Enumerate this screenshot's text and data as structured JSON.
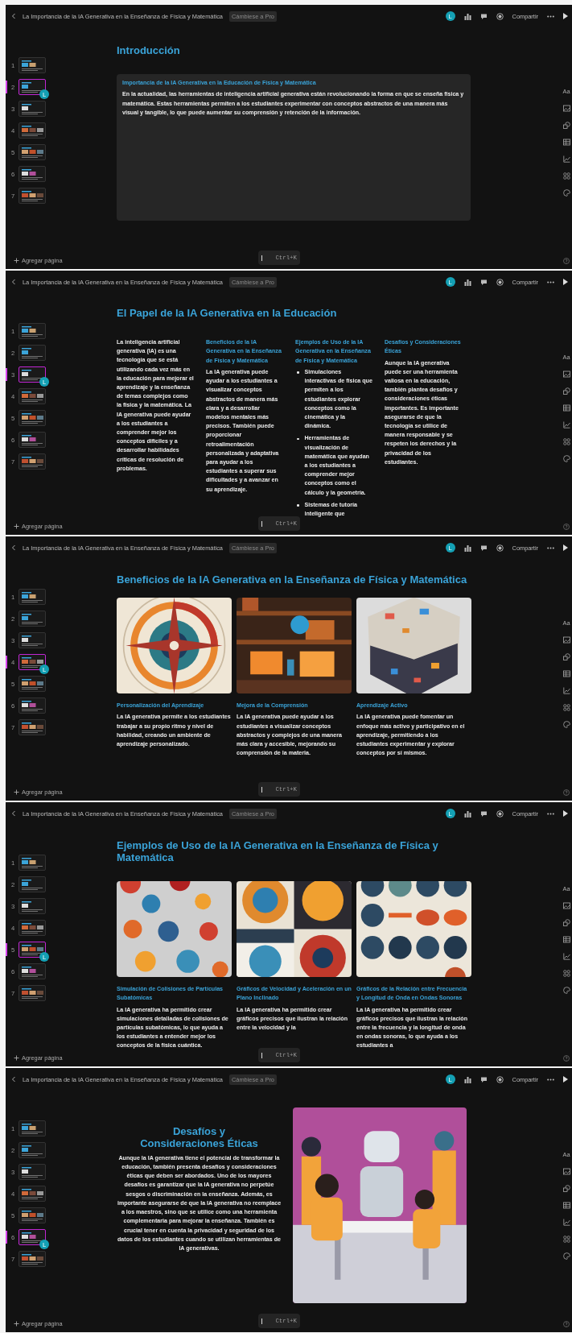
{
  "screens": [
    {
      "topbar": {
        "title": "La Importancia de la IA Generativa en la Enseñanza de Física y Matemática",
        "upgrade": "Cámbiese a Pro",
        "avatar": "L",
        "share": "Compartir"
      },
      "thumbnails": [
        {
          "number": "1",
          "selected": false
        },
        {
          "number": "2",
          "selected": true
        },
        {
          "number": "3",
          "selected": false
        },
        {
          "number": "4",
          "selected": false
        },
        {
          "number": "5",
          "selected": false
        },
        {
          "number": "6",
          "selected": false
        },
        {
          "number": "7",
          "selected": false
        }
      ],
      "cursor_badge": "L",
      "add_page": "Agregar página",
      "text_tool": "Aa",
      "shortcut": "Ctrl+K",
      "slide": {
        "kind": "text-card",
        "title": "Introducción",
        "heading": "Importancia de la IA Generativa en la Educación de Física y Matemática",
        "body": "En la actualidad, las herramientas de inteligencia artificial generativa están revolucionando la forma en que se enseña física y matemática. Estas herramientas permiten a los estudiantes experimentar con conceptos abstractos de una manera más visual y tangible, lo que puede aumentar su comprensión y retención de la información."
      }
    },
    {
      "topbar": {
        "title": "La Importancia de la IA Generativa en la Enseñanza de Física y Matemática",
        "upgrade": "Cámbiese a Pro",
        "avatar": "L",
        "share": "Compartir"
      },
      "thumbnails": [
        {
          "number": "1",
          "selected": false
        },
        {
          "number": "2",
          "selected": false
        },
        {
          "number": "3",
          "selected": true
        },
        {
          "number": "4",
          "selected": false
        },
        {
          "number": "5",
          "selected": false
        },
        {
          "number": "6",
          "selected": false
        },
        {
          "number": "7",
          "selected": false
        }
      ],
      "cursor_badge": "L",
      "add_page": "Agregar página",
      "text_tool": "Aa",
      "shortcut": "Ctrl+K",
      "slide": {
        "kind": "columns",
        "title": "El Papel de la IA Generativa en la Educación",
        "columns": [
          {
            "body": "La inteligencia artificial generativa (IA) es una tecnología que se está utilizando cada vez más en la educación para mejorar el aprendizaje y la enseñanza de temas complejos como la física y la matemática. La IA generativa puede ayudar a los estudiantes a comprender mejor los conceptos difíciles y a desarrollar habilidades críticas de resolución de problemas."
          },
          {
            "heading": "Beneficios de la IA Generativa en la Enseñanza de Física y Matemática",
            "body": "La IA generativa puede ayudar a los estudiantes a visualizar conceptos abstractos de manera más clara y a desarrollar modelos mentales más precisos. También puede proporcionar retroalimentación personalizada y adaptativa para ayudar a los estudiantes a superar sus dificultades y a avanzar en su aprendizaje."
          },
          {
            "heading": "Ejemplos de Uso de la IA Generativa en la Enseñanza de Física y Matemática",
            "bullets": [
              "Simulaciones interactivas de física que permiten a los estudiantes explorar conceptos como la cinemática y la dinámica.",
              "Herramientas de visualización de matemática que ayudan a los estudiantes a comprender mejor conceptos como el cálculo y la geometría.",
              "Sistemas de tutoría inteligente que"
            ]
          },
          {
            "heading": "Desafíos y Consideraciones Éticas",
            "body": "Aunque la IA generativa puede ser una herramienta valiosa en la educación, también plantea desafíos y consideraciones éticas importantes. Es importante asegurarse de que la tecnología se utilice de manera responsable y se respeten los derechos y la privacidad de los estudiantes."
          }
        ]
      }
    },
    {
      "topbar": {
        "title": "La Importancia de la IA Generativa en la Enseñanza de Física y Matemática",
        "upgrade": "Cámbiese a Pro",
        "avatar": "L",
        "share": "Compartir"
      },
      "thumbnails": [
        {
          "number": "1",
          "selected": false
        },
        {
          "number": "2",
          "selected": false
        },
        {
          "number": "3",
          "selected": false
        },
        {
          "number": "4",
          "selected": true
        },
        {
          "number": "5",
          "selected": false
        },
        {
          "number": "6",
          "selected": false
        },
        {
          "number": "7",
          "selected": false
        }
      ],
      "cursor_badge": "L",
      "add_page": "Agregar página",
      "text_tool": "Aa",
      "shortcut": "Ctrl+K",
      "slide": {
        "kind": "image-cards",
        "title": "Beneficios de la IA Generativa en la Enseñanza de Física y Matemática",
        "cards": [
          {
            "heading": "Personalización del Aprendizaje",
            "body": "La IA generativa permite a los estudiantes trabajar a su propio ritmo y nivel de habilidad, creando un ambiente de aprendizaje personalizado."
          },
          {
            "heading": "Mejora de la Comprensión",
            "body": "La IA generativa puede ayudar a los estudiantes a visualizar conceptos abstractos y complejos de una manera más clara y accesible, mejorando su comprensión de la materia."
          },
          {
            "heading": "Aprendizaje Activo",
            "body": "La IA generativa puede fomentar un enfoque más activo y participativo en el aprendizaje, permitiendo a los estudiantes experimentar y explorar conceptos por sí mismos."
          }
        ]
      }
    },
    {
      "topbar": {
        "title": "La Importancia de la IA Generativa en la Enseñanza de Física y Matemática",
        "upgrade": "Cámbiese a Pro",
        "avatar": "L",
        "share": "Compartir"
      },
      "thumbnails": [
        {
          "number": "1",
          "selected": false
        },
        {
          "number": "2",
          "selected": false
        },
        {
          "number": "3",
          "selected": false
        },
        {
          "number": "4",
          "selected": false
        },
        {
          "number": "5",
          "selected": true
        },
        {
          "number": "6",
          "selected": false
        },
        {
          "number": "7",
          "selected": false
        }
      ],
      "cursor_badge": "L",
      "add_page": "Agregar página",
      "text_tool": "Aa",
      "shortcut": "Ctrl+K",
      "slide": {
        "kind": "image-cards",
        "title": "Ejemplos de Uso de la IA Generativa en la Enseñanza de Física y Matemática",
        "cards": [
          {
            "heading": "Simulación de Colisiones de Partículas Subatómicas",
            "body": "La IA generativa ha permitido crear simulaciones detalladas de colisiones de partículas subatómicas, lo que ayuda a los estudiantes a entender mejor los conceptos de la física cuántica."
          },
          {
            "heading": "Gráficos de Velocidad y Aceleración en un Plano Inclinado",
            "body": "La IA generativa ha permitido crear gráficos precisos que ilustran la relación entre la velocidad y la"
          },
          {
            "heading": "Gráficos de la Relación entre Frecuencia y Longitud de Onda en Ondas Sonoras",
            "body": "La IA generativa ha permitido crear gráficos precisos que ilustran la relación entre la frecuencia y la longitud de onda en ondas sonoras, lo que ayuda a los estudiantes a"
          }
        ]
      }
    },
    {
      "topbar": {
        "title": "La Importancia de la IA Generativa en la Enseñanza de Física y Matemática",
        "upgrade": "Cámbiese a Pro",
        "avatar": "L",
        "share": "Compartir"
      },
      "thumbnails": [
        {
          "number": "1",
          "selected": false
        },
        {
          "number": "2",
          "selected": false
        },
        {
          "number": "3",
          "selected": false
        },
        {
          "number": "4",
          "selected": false
        },
        {
          "number": "5",
          "selected": false
        },
        {
          "number": "6",
          "selected": true
        },
        {
          "number": "7",
          "selected": false
        }
      ],
      "cursor_badge": "L",
      "add_page": "Agregar página",
      "text_tool": "Aa",
      "shortcut": "Ctrl+K",
      "slide": {
        "kind": "image-text",
        "title": "Desafíos y Consideraciones Éticas",
        "body": "Aunque la IA generativa tiene el potencial de transformar la educación, también presenta desafíos y consideraciones éticas que deben ser abordados. Uno de los mayores desafíos es garantizar que la IA generativa no perpetúe sesgos o discriminación en la enseñanza. Además, es importante asegurarse de que la IA generativa no reemplace a los maestros, sino que se utilice como una herramienta complementaria para mejorar la enseñanza. También es crucial tener en cuenta la privacidad y seguridad de los datos de los estudiantes cuando se utilizan herramientas de IA generativas."
      }
    }
  ]
}
